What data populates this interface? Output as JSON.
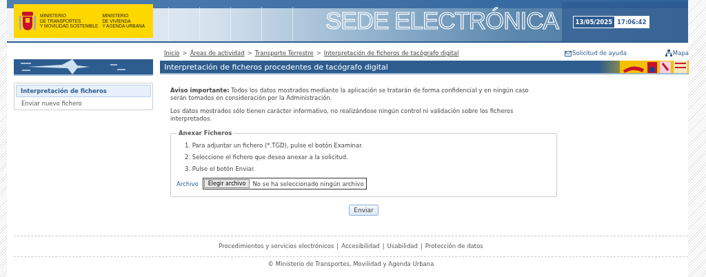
{
  "header": {
    "ministries": [
      {
        "lines": [
          "MINISTERIO",
          "DE TRANSPORTES",
          "Y MOVILIDAD SOSTENIBLE"
        ]
      },
      {
        "lines": [
          "MINISTERIO",
          "DE VIVIENDA",
          "Y AGENDA URBANA"
        ]
      }
    ],
    "site_title": "SEDE ELECTRÓNICA",
    "date": "13/05/2025",
    "time": "17:06:42"
  },
  "breadcrumb": {
    "separator": ">",
    "items": [
      "Inicio",
      "Áreas de actividad",
      "Transporte Terrestre",
      "Interpretación de ficheros de tacógrafo digital"
    ]
  },
  "top_links": [
    {
      "kind": "help",
      "label": "Solicitud de ayuda"
    },
    {
      "kind": "map",
      "label": "Mapa"
    }
  ],
  "page_title": "Interpretación de ficheros procedentes de tacógrafo digital",
  "sidebar": {
    "items": [
      {
        "label": "Interpretación de ficheros",
        "selected": true
      },
      {
        "label": "Enviar nuevo fichero",
        "selected": false
      }
    ]
  },
  "notices": [
    "**Aviso importante:** Todos los datos mostrados mediante la aplicación se tratarán de forma confidencial y en ningún caso serán tomados en consideración por la Administración.",
    "Los datos mostrados sólo tienen carácter informativo, no realizándose ningún control ni validación sobre los ficheros interpretados."
  ],
  "fieldset": {
    "legend": "Anexar Ficheros",
    "steps": [
      "1. Para adjuntar un fichero (*.TGD), pulse el botón Examinar.",
      "2. Seleccione el fichero que desea anexar a la solicitud.",
      "3. Pulse el botón Enviar."
    ],
    "file": {
      "label": "Archivo",
      "button": "Elegir archivo",
      "status": "No se ha seleccionado ningún archivo"
    }
  },
  "submit": "Enviar",
  "footer": {
    "separator": "|",
    "links": [
      "Procedimientos y servicios electrónicos",
      "Accesibilidad",
      "Usabilidad",
      "Protección de datos"
    ],
    "copyright": "© Ministerio de Transportes, Movilidad y Agenda Urbana"
  }
}
